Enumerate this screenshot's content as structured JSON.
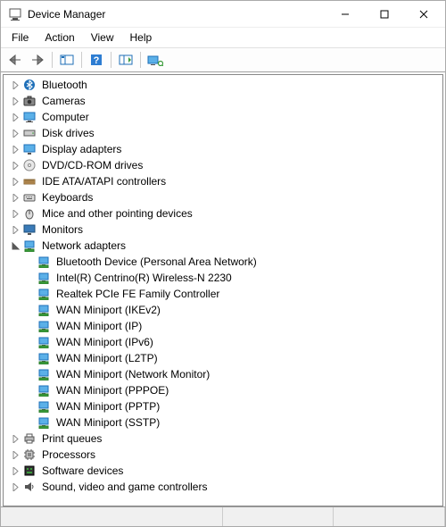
{
  "window": {
    "title": "Device Manager"
  },
  "menubar": {
    "file": "File",
    "action": "Action",
    "view": "View",
    "help": "Help"
  },
  "tree": {
    "items": [
      {
        "label": "Bluetooth",
        "icon": "bluetooth",
        "expanded": false
      },
      {
        "label": "Cameras",
        "icon": "camera",
        "expanded": false
      },
      {
        "label": "Computer",
        "icon": "computer",
        "expanded": false
      },
      {
        "label": "Disk drives",
        "icon": "disk",
        "expanded": false
      },
      {
        "label": "Display adapters",
        "icon": "display",
        "expanded": false
      },
      {
        "label": "DVD/CD-ROM drives",
        "icon": "cdrom",
        "expanded": false
      },
      {
        "label": "IDE ATA/ATAPI controllers",
        "icon": "ide",
        "expanded": false
      },
      {
        "label": "Keyboards",
        "icon": "keyboard",
        "expanded": false
      },
      {
        "label": "Mice and other pointing devices",
        "icon": "mouse",
        "expanded": false
      },
      {
        "label": "Monitors",
        "icon": "monitor",
        "expanded": false
      },
      {
        "label": "Network adapters",
        "icon": "network",
        "expanded": true,
        "children": [
          {
            "label": "Bluetooth Device (Personal Area Network)"
          },
          {
            "label": "Intel(R) Centrino(R) Wireless-N 2230"
          },
          {
            "label": "Realtek PCIe FE Family Controller"
          },
          {
            "label": "WAN Miniport (IKEv2)"
          },
          {
            "label": "WAN Miniport (IP)"
          },
          {
            "label": "WAN Miniport (IPv6)"
          },
          {
            "label": "WAN Miniport (L2TP)"
          },
          {
            "label": "WAN Miniport (Network Monitor)"
          },
          {
            "label": "WAN Miniport (PPPOE)"
          },
          {
            "label": "WAN Miniport (PPTP)"
          },
          {
            "label": "WAN Miniport (SSTP)"
          }
        ]
      },
      {
        "label": "Print queues",
        "icon": "printer",
        "expanded": false
      },
      {
        "label": "Processors",
        "icon": "cpu",
        "expanded": false
      },
      {
        "label": "Software devices",
        "icon": "software",
        "expanded": false
      },
      {
        "label": "Sound, video and game controllers",
        "icon": "sound",
        "expanded": false
      }
    ]
  }
}
